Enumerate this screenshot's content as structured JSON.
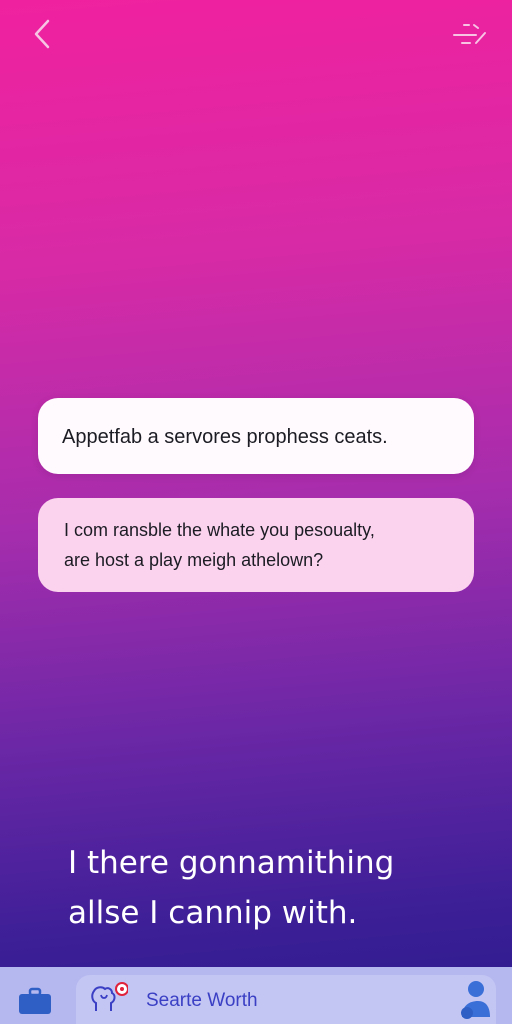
{
  "header": {
    "back_icon": "chevron-left-icon",
    "share_icon": "share-icon"
  },
  "messages": [
    {
      "text": "Appetfab a servores prophess ceats."
    },
    {
      "lines": [
        "I com ransble the whate you pesoualty,",
        "are host a play meigh athelown?"
      ]
    }
  ],
  "caption": {
    "lines": [
      "I there gonnamithing",
      "allse I cannip with."
    ]
  },
  "bottom_bar": {
    "left_icon": "briefcase-icon",
    "search_label": "Searte Worth",
    "search_icon": "brain-icon",
    "right_icon": "user-icon"
  },
  "colors": {
    "gradient_top": "#f0219f",
    "gradient_bottom": "#2a1a8c",
    "bubble_1": "#fffafd",
    "bubble_2": "#fbd3ee",
    "accent_blue": "#3a3fc4"
  }
}
